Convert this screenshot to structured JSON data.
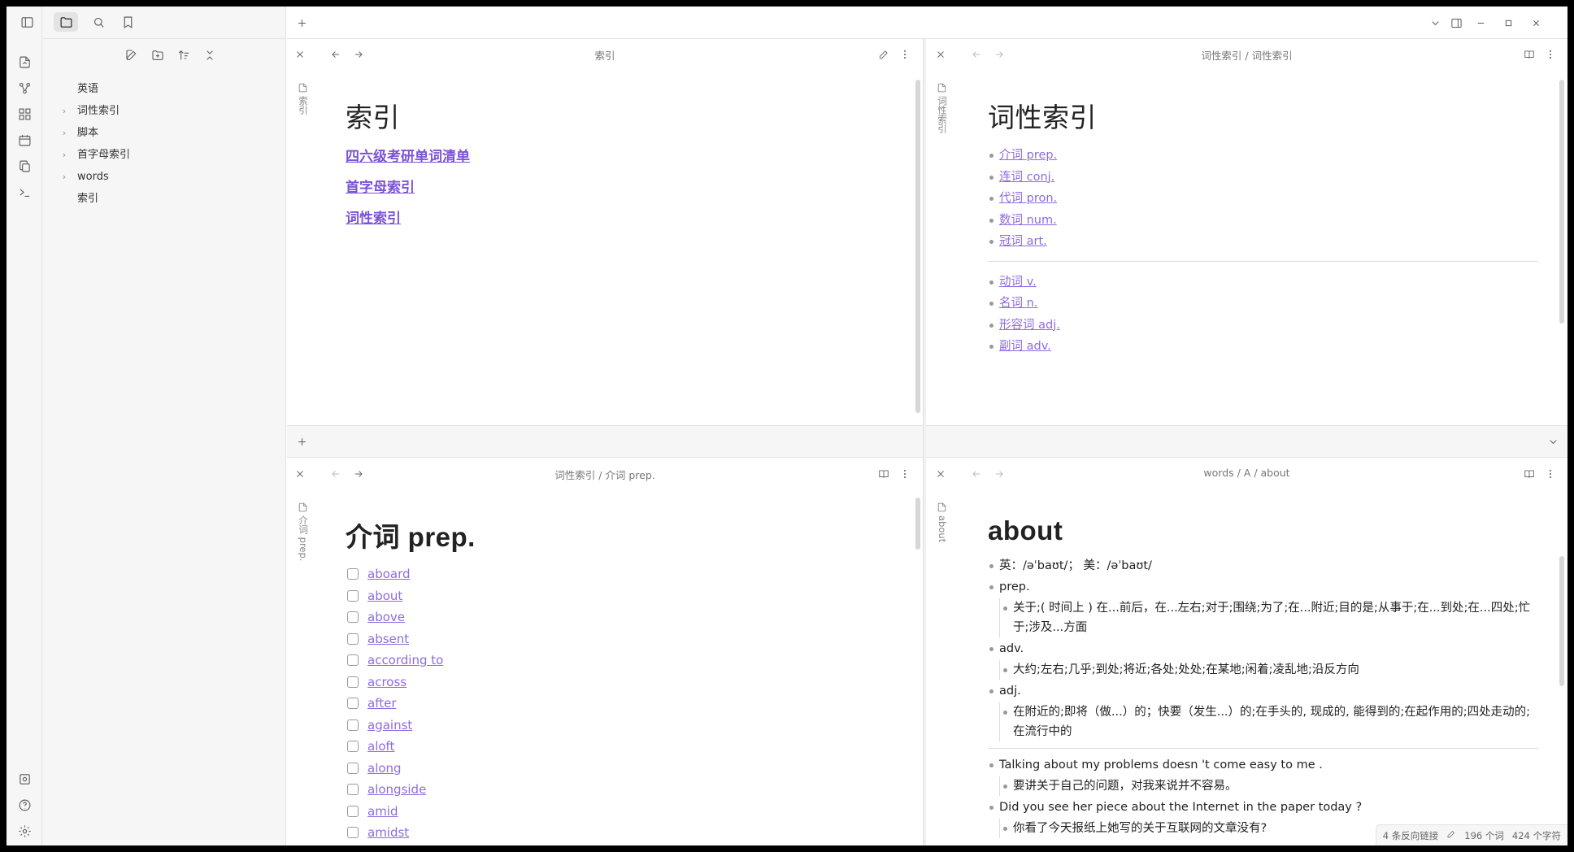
{
  "sidebar": {
    "tree": [
      {
        "label": "英语",
        "has_children": false
      },
      {
        "label": "词性索引",
        "has_children": true
      },
      {
        "label": "脚本",
        "has_children": true
      },
      {
        "label": "首字母索引",
        "has_children": true
      },
      {
        "label": "words",
        "has_children": true
      },
      {
        "label": "索引",
        "has_children": false
      }
    ]
  },
  "panes": {
    "top_left": {
      "title": "索引",
      "vertical_title": "索引",
      "heading": "索引",
      "links": [
        "四六级考研单词清单",
        "首字母索引",
        "词性索引"
      ]
    },
    "top_right": {
      "title": "词性索引 / 词性索引",
      "vertical_title": "词性索引",
      "heading": "词性索引",
      "group1": [
        "介词 prep.",
        "连词 conj.",
        "代词 pron.",
        "数词 num.",
        "冠词 art."
      ],
      "group2": [
        "动词 v.",
        "名词 n.",
        "形容词 adj.",
        "副词 adv."
      ]
    },
    "bottom_left": {
      "title": "词性索引 / 介词 prep.",
      "vertical_title": "介词 prep.",
      "heading": "介词 prep.",
      "items": [
        "aboard",
        "about",
        "above",
        "absent",
        "according to",
        "across",
        "after",
        "against",
        "aloft",
        "along",
        "alongside",
        "amid",
        "amidst"
      ]
    },
    "bottom_right": {
      "title": "words / A / about",
      "vertical_title": "about",
      "heading": "about",
      "phonetic": "英：/əˈbaʊt/；  美：/əˈbaʊt/",
      "pos1": "prep.",
      "pos1_def": "关于;( 时间上 ) 在...前后，在...左右;对于;围绕;为了;在...附近;目的是;从事于;在...到处;在...四处;忙于;涉及...方面",
      "pos2": "adv.",
      "pos2_def": "大约;左右;几乎;到处;将近;各处;处处;在某地;闲着;凌乱地;沿反方向",
      "pos3": "adj.",
      "pos3_def": "在附近的;即将（做...）的；快要（发生...）的;在手头的, 现成的, 能得到的;在起作用的;四处走动的;在流行中的",
      "ex1": "Talking about my problems doesn 't come easy to me .",
      "ex1_cn": "要讲关于自己的问题，对我来说并不容易。",
      "ex2": "Did you see her piece about the Internet in the paper today ?",
      "ex2_cn": "你看了今天报纸上她写的关于互联网的文章没有?"
    }
  },
  "status": {
    "backlinks": "4 条反向链接",
    "words": "196 个词",
    "chars": "424 个字符"
  }
}
